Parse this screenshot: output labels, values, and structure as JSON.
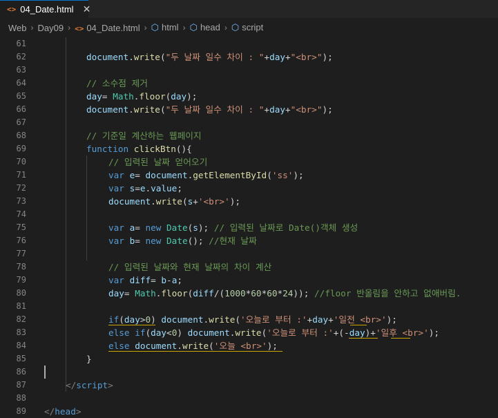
{
  "tab": {
    "icon": "<>",
    "title": "04_Date.html",
    "close": "✕"
  },
  "breadcrumb": [
    {
      "label": "Web",
      "icon": ""
    },
    {
      "label": "Day09",
      "icon": ""
    },
    {
      "label": "04_Date.html",
      "icon": "code-icon"
    },
    {
      "label": "html",
      "icon": "cube-icon"
    },
    {
      "label": "head",
      "icon": "cube-icon"
    },
    {
      "label": "script",
      "icon": "cube-icon"
    }
  ],
  "editor": {
    "colors": {
      "background": "#1e1e1e",
      "keyword": "#569cd6",
      "string": "#ce9178",
      "comment": "#6a9955",
      "function": "#dcdcaa",
      "variable": "#9cdcfe",
      "class": "#4ec9b0",
      "number": "#b5cea8",
      "line_number": "#858585"
    },
    "lines": [
      {
        "no": "61",
        "tokens": []
      },
      {
        "no": "62",
        "tokens": [
          {
            "t": "document",
            "c": "id"
          },
          {
            "t": ".",
            "c": "pl"
          },
          {
            "t": "write",
            "c": "fn"
          },
          {
            "t": "(",
            "c": "pl"
          },
          {
            "t": "\"두 날짜 일수 차이 : \"",
            "c": "st"
          },
          {
            "t": "+",
            "c": "pl"
          },
          {
            "t": "day",
            "c": "id"
          },
          {
            "t": "+",
            "c": "pl"
          },
          {
            "t": "\"<br>\"",
            "c": "st"
          },
          {
            "t": ");",
            "c": "pl"
          }
        ]
      },
      {
        "no": "63",
        "tokens": []
      },
      {
        "no": "64",
        "tokens": [
          {
            "t": "// 소수점 제거",
            "c": "cm"
          }
        ]
      },
      {
        "no": "65",
        "tokens": [
          {
            "t": "day",
            "c": "id"
          },
          {
            "t": "= ",
            "c": "pl"
          },
          {
            "t": "Math",
            "c": "cl"
          },
          {
            "t": ".",
            "c": "pl"
          },
          {
            "t": "floor",
            "c": "fn"
          },
          {
            "t": "(",
            "c": "pl"
          },
          {
            "t": "day",
            "c": "id"
          },
          {
            "t": ");",
            "c": "pl"
          }
        ]
      },
      {
        "no": "66",
        "tokens": [
          {
            "t": "document",
            "c": "id"
          },
          {
            "t": ".",
            "c": "pl"
          },
          {
            "t": "write",
            "c": "fn"
          },
          {
            "t": "(",
            "c": "pl"
          },
          {
            "t": "\"두 날짜 일수 차이 : \"",
            "c": "st"
          },
          {
            "t": "+",
            "c": "pl"
          },
          {
            "t": "day",
            "c": "id"
          },
          {
            "t": "+",
            "c": "pl"
          },
          {
            "t": "\"<br>\"",
            "c": "st"
          },
          {
            "t": ");",
            "c": "pl"
          }
        ]
      },
      {
        "no": "67",
        "tokens": []
      },
      {
        "no": "68",
        "tokens": [
          {
            "t": "// 기준일 계산하는 웹페이지",
            "c": "cm"
          }
        ]
      },
      {
        "no": "69",
        "tokens": [
          {
            "t": "function",
            "c": "kw"
          },
          {
            "t": " ",
            "c": "pl"
          },
          {
            "t": "clickBtn",
            "c": "fn"
          },
          {
            "t": "(){",
            "c": "pl"
          }
        ]
      },
      {
        "no": "70",
        "tokens": [
          {
            "t": "// 입력된 날짜 얻어오기",
            "c": "cm"
          }
        ]
      },
      {
        "no": "71",
        "tokens": [
          {
            "t": "var",
            "c": "kw"
          },
          {
            "t": " ",
            "c": "pl"
          },
          {
            "t": "e",
            "c": "id"
          },
          {
            "t": "= ",
            "c": "pl"
          },
          {
            "t": "document",
            "c": "id"
          },
          {
            "t": ".",
            "c": "pl"
          },
          {
            "t": "getElementById",
            "c": "fn"
          },
          {
            "t": "(",
            "c": "pl"
          },
          {
            "t": "'ss'",
            "c": "st"
          },
          {
            "t": ");",
            "c": "pl"
          }
        ]
      },
      {
        "no": "72",
        "tokens": [
          {
            "t": "var",
            "c": "kw"
          },
          {
            "t": " ",
            "c": "pl"
          },
          {
            "t": "s",
            "c": "id"
          },
          {
            "t": "=",
            "c": "pl"
          },
          {
            "t": "e",
            "c": "id"
          },
          {
            "t": ".",
            "c": "pl"
          },
          {
            "t": "value",
            "c": "id"
          },
          {
            "t": ";",
            "c": "pl"
          }
        ]
      },
      {
        "no": "73",
        "tokens": [
          {
            "t": "document",
            "c": "id"
          },
          {
            "t": ".",
            "c": "pl"
          },
          {
            "t": "write",
            "c": "fn"
          },
          {
            "t": "(",
            "c": "pl"
          },
          {
            "t": "s",
            "c": "id"
          },
          {
            "t": "+",
            "c": "pl"
          },
          {
            "t": "'<br>'",
            "c": "st"
          },
          {
            "t": ");",
            "c": "pl"
          }
        ]
      },
      {
        "no": "74",
        "tokens": []
      },
      {
        "no": "75",
        "tokens": [
          {
            "t": "var",
            "c": "kw"
          },
          {
            "t": " ",
            "c": "pl"
          },
          {
            "t": "a",
            "c": "id"
          },
          {
            "t": "= ",
            "c": "pl"
          },
          {
            "t": "new",
            "c": "kw"
          },
          {
            "t": " ",
            "c": "pl"
          },
          {
            "t": "Date",
            "c": "cl"
          },
          {
            "t": "(",
            "c": "pl"
          },
          {
            "t": "s",
            "c": "id"
          },
          {
            "t": "); ",
            "c": "pl"
          },
          {
            "t": "// 입력된 날짜로 Date()객체 생성",
            "c": "cm"
          }
        ]
      },
      {
        "no": "76",
        "tokens": [
          {
            "t": "var",
            "c": "kw"
          },
          {
            "t": " ",
            "c": "pl"
          },
          {
            "t": "b",
            "c": "id"
          },
          {
            "t": "= ",
            "c": "pl"
          },
          {
            "t": "new",
            "c": "kw"
          },
          {
            "t": " ",
            "c": "pl"
          },
          {
            "t": "Date",
            "c": "cl"
          },
          {
            "t": "(); ",
            "c": "pl"
          },
          {
            "t": "//현재 날짜",
            "c": "cm"
          }
        ]
      },
      {
        "no": "77",
        "tokens": []
      },
      {
        "no": "78",
        "tokens": [
          {
            "t": "// 입력된 날짜와 현재 날짜의 차이 계산",
            "c": "cm"
          }
        ]
      },
      {
        "no": "79",
        "tokens": [
          {
            "t": "var",
            "c": "kw"
          },
          {
            "t": " ",
            "c": "pl"
          },
          {
            "t": "diff",
            "c": "id"
          },
          {
            "t": "= ",
            "c": "pl"
          },
          {
            "t": "b",
            "c": "id"
          },
          {
            "t": "-",
            "c": "pl"
          },
          {
            "t": "a",
            "c": "id"
          },
          {
            "t": ";",
            "c": "pl"
          }
        ]
      },
      {
        "no": "80",
        "tokens": [
          {
            "t": "day",
            "c": "id"
          },
          {
            "t": "= ",
            "c": "pl"
          },
          {
            "t": "Math",
            "c": "cl"
          },
          {
            "t": ".",
            "c": "pl"
          },
          {
            "t": "floor",
            "c": "fn"
          },
          {
            "t": "(",
            "c": "pl"
          },
          {
            "t": "diff",
            "c": "id"
          },
          {
            "t": "/(",
            "c": "pl"
          },
          {
            "t": "1000",
            "c": "nu"
          },
          {
            "t": "*",
            "c": "pl"
          },
          {
            "t": "60",
            "c": "nu"
          },
          {
            "t": "*",
            "c": "pl"
          },
          {
            "t": "60",
            "c": "nu"
          },
          {
            "t": "*",
            "c": "pl"
          },
          {
            "t": "24",
            "c": "nu"
          },
          {
            "t": ")); ",
            "c": "pl"
          },
          {
            "t": "//floor 반올림을 안하고 없애버림.",
            "c": "cm"
          }
        ]
      },
      {
        "no": "81",
        "tokens": []
      },
      {
        "no": "82",
        "tokens": [
          {
            "t": "if",
            "c": "kw"
          },
          {
            "t": "(",
            "c": "pl"
          },
          {
            "t": "day",
            "c": "id"
          },
          {
            "t": ">",
            "c": "pl"
          },
          {
            "t": "0",
            "c": "nu"
          },
          {
            "t": ") ",
            "c": "pl"
          },
          {
            "t": "document",
            "c": "id"
          },
          {
            "t": ".",
            "c": "pl"
          },
          {
            "t": "write",
            "c": "fn"
          },
          {
            "t": "(",
            "c": "pl"
          },
          {
            "t": "'오늘로 부터 :'",
            "c": "st"
          },
          {
            "t": "+",
            "c": "pl"
          },
          {
            "t": "day",
            "c": "id"
          },
          {
            "t": "+",
            "c": "pl"
          },
          {
            "t": "'일전 <br>'",
            "c": "st"
          },
          {
            "t": ");",
            "c": "pl"
          }
        ]
      },
      {
        "no": "83",
        "tokens": [
          {
            "t": "else",
            "c": "kw"
          },
          {
            "t": " ",
            "c": "pl"
          },
          {
            "t": "if",
            "c": "kw"
          },
          {
            "t": "(",
            "c": "pl"
          },
          {
            "t": "day",
            "c": "id"
          },
          {
            "t": "<",
            "c": "pl"
          },
          {
            "t": "0",
            "c": "nu"
          },
          {
            "t": ") ",
            "c": "pl"
          },
          {
            "t": "document",
            "c": "id"
          },
          {
            "t": ".",
            "c": "pl"
          },
          {
            "t": "write",
            "c": "fn"
          },
          {
            "t": "(",
            "c": "pl"
          },
          {
            "t": "'오늘로 부터 :'",
            "c": "st"
          },
          {
            "t": "+(-",
            "c": "pl"
          },
          {
            "t": "day",
            "c": "id"
          },
          {
            "t": ")+",
            "c": "pl"
          },
          {
            "t": "'일후 <br>'",
            "c": "st"
          },
          {
            "t": ");",
            "c": "pl"
          }
        ]
      },
      {
        "no": "84",
        "tokens": [
          {
            "t": "else",
            "c": "kw"
          },
          {
            "t": " ",
            "c": "pl"
          },
          {
            "t": "document",
            "c": "id"
          },
          {
            "t": ".",
            "c": "pl"
          },
          {
            "t": "write",
            "c": "fn"
          },
          {
            "t": "(",
            "c": "pl"
          },
          {
            "t": "'오늘 <br>'",
            "c": "st"
          },
          {
            "t": ");",
            "c": "pl"
          }
        ]
      },
      {
        "no": "85",
        "tokens": [
          {
            "t": "}",
            "c": "pl"
          }
        ]
      },
      {
        "no": "86",
        "tokens": []
      },
      {
        "no": "87",
        "tokens": [
          {
            "t": "</",
            "c": "tg"
          },
          {
            "t": "script",
            "c": "kw"
          },
          {
            "t": ">",
            "c": "tg"
          }
        ]
      },
      {
        "no": "88",
        "tokens": []
      },
      {
        "no": "89",
        "tokens": [
          {
            "t": "</",
            "c": "tg"
          },
          {
            "t": "head",
            "c": "kw"
          },
          {
            "t": ">",
            "c": "tg"
          }
        ]
      }
    ]
  }
}
